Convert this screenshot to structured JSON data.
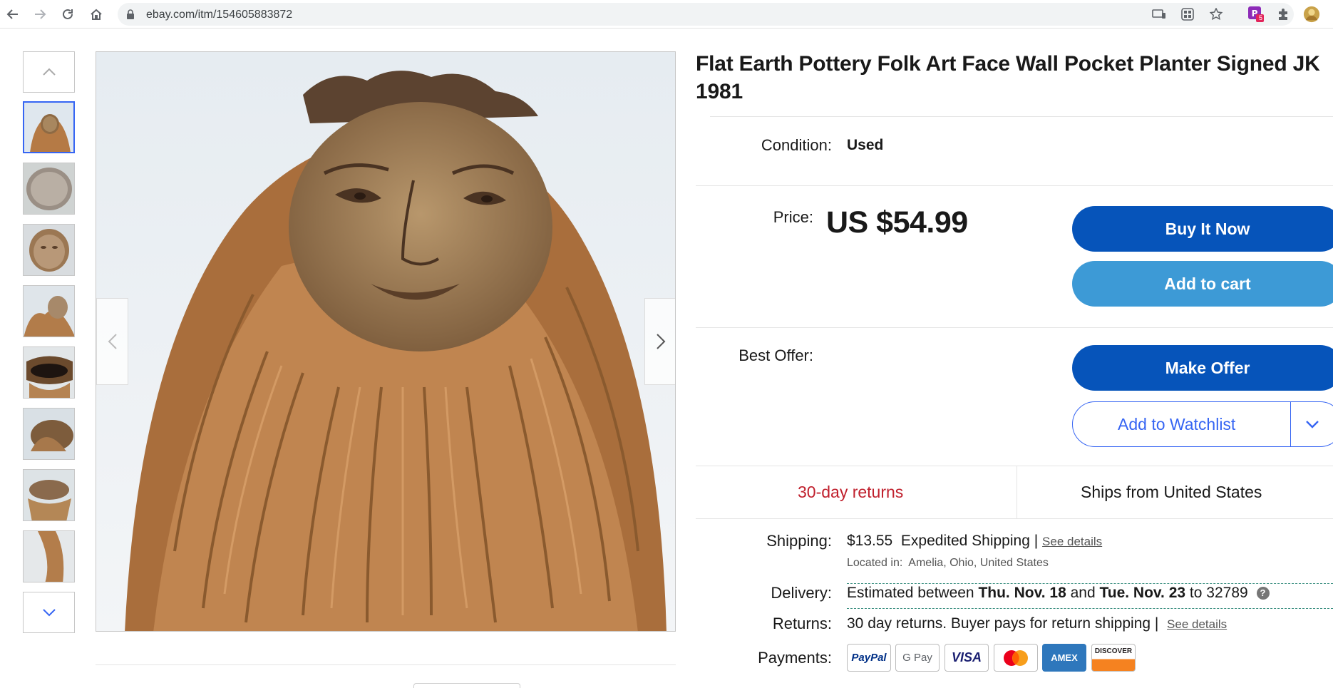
{
  "browser": {
    "url": "ebay.com/itm/154605883872",
    "extension_badge": "5"
  },
  "gallery": {
    "thumbnails": [
      "thumb-1",
      "thumb-2",
      "thumb-3",
      "thumb-4",
      "thumb-5",
      "thumb-6",
      "thumb-7",
      "thumb-8"
    ],
    "active_index": 0
  },
  "item": {
    "title": "Flat Earth Pottery Folk Art Face Wall Pocket Planter Signed JK 1981",
    "condition_label": "Condition:",
    "condition_value": "Used",
    "price_label": "Price:",
    "price_value": "US $54.99",
    "best_offer_label": "Best Offer:"
  },
  "actions": {
    "buy_now": "Buy It Now",
    "add_to_cart": "Add to cart",
    "make_offer": "Make Offer",
    "add_to_watchlist": "Add to Watchlist"
  },
  "highlights": {
    "returns": "30-day returns",
    "ships_from": "Ships from United States"
  },
  "shipping": {
    "label": "Shipping:",
    "cost": "$13.55",
    "method": "Expedited Shipping",
    "separator": "|",
    "see_details": "See details",
    "located_in_label": "Located in:",
    "located_in": "Amelia, Ohio, United States"
  },
  "delivery": {
    "label": "Delivery:",
    "prefix": "Estimated between",
    "start": "Thu. Nov. 18",
    "and": "and",
    "end": "Tue. Nov. 23",
    "to": "to",
    "zip": "32789",
    "help": "?"
  },
  "returns": {
    "label": "Returns:",
    "text": "30 day returns. Buyer pays for return shipping",
    "separator": "|",
    "see_details": "See details"
  },
  "payments": {
    "label": "Payments:",
    "methods": [
      "PayPal",
      "G Pay",
      "VISA",
      "Mastercard",
      "AMEX",
      "DISCOVER"
    ]
  },
  "colors": {
    "primary_button": "#0654ba",
    "secondary_button": "#3d9ad6",
    "returns_red": "#c0202d",
    "link_blue": "#3665f3"
  }
}
